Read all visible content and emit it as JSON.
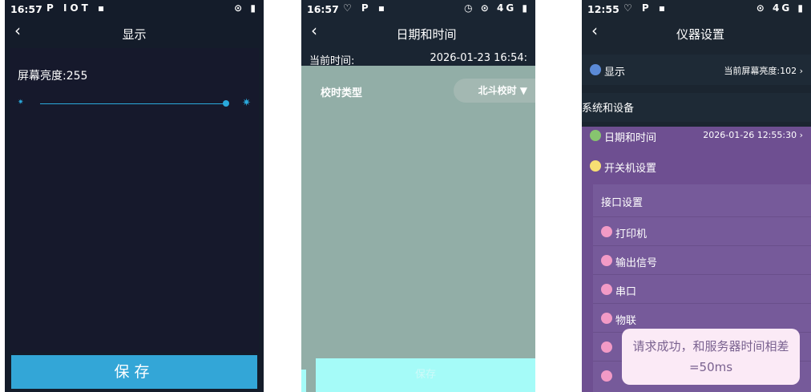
{
  "panel1": {
    "time": "16:57",
    "status_icons": "P IOT ▪",
    "status_right": "⊙ ▮",
    "title": "显示",
    "brightness_label": "屏幕亮度:255",
    "brightness_value": 255,
    "save_label": "保存",
    "accent": "#33a6d7"
  },
  "panel2": {
    "time": "16:57",
    "status_icons": "♡ P ▪",
    "status_right": "◷ ⊙ 4G ▮",
    "title": "日期和时间",
    "current_time_label": "当前时间:",
    "current_time_value": "2026-01-23 16:54:",
    "timing_type_label": "校时类型",
    "timing_type_value": "北斗校时 ▼",
    "save_label": "保存"
  },
  "panel3": {
    "time": "12:55",
    "status_icons": "♡ P ▪",
    "status_right": "⊙ 4G ▮",
    "title": "仪器设置",
    "display_label": "显示",
    "display_value": "当前屏幕亮度:102",
    "system_header": "系统和设备",
    "datetime_label": "日期和时间",
    "datetime_value": "2026-01-26 12:55:30",
    "power_label": "开关机设置",
    "interface_header": "接口设置",
    "interface_items": [
      "打印机",
      "输出信号",
      "串口",
      "物联",
      "",
      ""
    ],
    "toast": "请求成功，和服务器时间相差=50ms"
  }
}
